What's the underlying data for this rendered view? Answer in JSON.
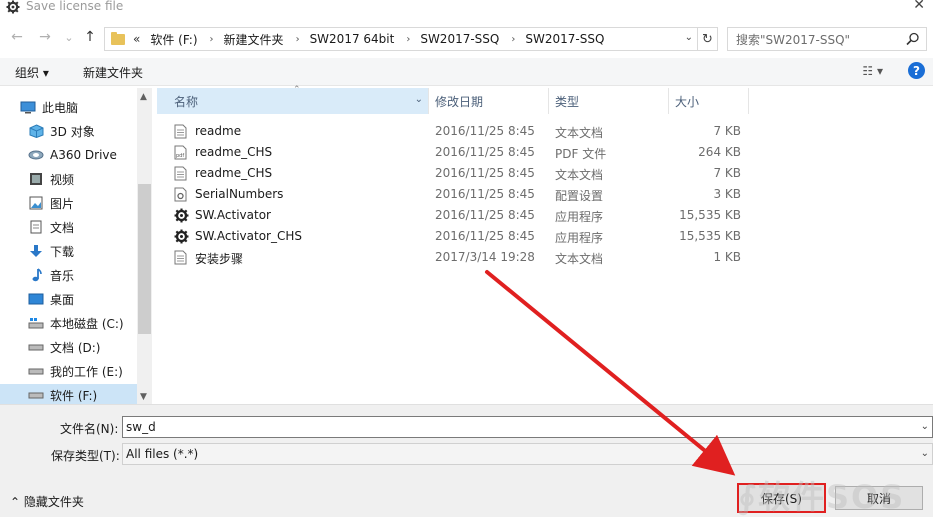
{
  "window": {
    "title": "Save license file",
    "close_glyph": "✕"
  },
  "nav": {
    "back": "←",
    "forward": "→",
    "recent": "⌄",
    "up": "↑",
    "breadcrumb_lead": "«",
    "breadcrumb": [
      "软件 (F:)",
      "新建文件夹",
      "SW2017 64bit",
      "SW2017-SSQ",
      "SW2017-SSQ"
    ],
    "crumb_sep": "›",
    "search_placeholder": "搜索\"SW2017-SSQ\""
  },
  "toolbar": {
    "organize": "组织 ▾",
    "new_folder": "新建文件夹",
    "view_glyph": "☷ ▾",
    "help": "?"
  },
  "sidebar": {
    "items": [
      {
        "label": "此电脑",
        "icon": "computer-icon"
      },
      {
        "label": "3D 对象",
        "icon": "3d-objects-icon"
      },
      {
        "label": "A360 Drive",
        "icon": "cloud-drive-icon"
      },
      {
        "label": "视频",
        "icon": "video-icon"
      },
      {
        "label": "图片",
        "icon": "pictures-icon"
      },
      {
        "label": "文档",
        "icon": "documents-icon"
      },
      {
        "label": "下载",
        "icon": "download-icon"
      },
      {
        "label": "音乐",
        "icon": "music-icon"
      },
      {
        "label": "桌面",
        "icon": "desktop-icon"
      },
      {
        "label": "本地磁盘 (C:)",
        "icon": "system-drive-icon"
      },
      {
        "label": "文档 (D:)",
        "icon": "drive-icon"
      },
      {
        "label": "我的工作 (E:)",
        "icon": "drive-icon"
      },
      {
        "label": "软件 (F:)",
        "icon": "drive-icon"
      }
    ]
  },
  "columns": {
    "name": "名称",
    "date": "修改日期",
    "type": "类型",
    "size": "大小"
  },
  "files": [
    {
      "name": "readme",
      "date": "2016/11/25 8:45",
      "type": "文本文档",
      "size": "7 KB",
      "icon": "text-file-icon"
    },
    {
      "name": "readme_CHS",
      "date": "2016/11/25 8:45",
      "type": "PDF 文件",
      "size": "264 KB",
      "icon": "pdf-file-icon"
    },
    {
      "name": "readme_CHS",
      "date": "2016/11/25 8:45",
      "type": "文本文档",
      "size": "7 KB",
      "icon": "text-file-icon"
    },
    {
      "name": "SerialNumbers",
      "date": "2016/11/25 8:45",
      "type": "配置设置",
      "size": "3 KB",
      "icon": "config-file-icon"
    },
    {
      "name": "SW.Activator",
      "date": "2016/11/25 8:45",
      "type": "应用程序",
      "size": "15,535 KB",
      "icon": "gear-icon"
    },
    {
      "name": "SW.Activator_CHS",
      "date": "2016/11/25 8:45",
      "type": "应用程序",
      "size": "15,535 KB",
      "icon": "gear-icon"
    },
    {
      "name": "安装步骤",
      "date": "2017/3/14 19:28",
      "type": "文本文档",
      "size": "1 KB",
      "icon": "text-file-icon"
    }
  ],
  "form": {
    "filename_label": "文件名(N):",
    "filename_value": "sw_d",
    "filetype_label": "保存类型(T):",
    "filetype_value": "All files (*.*)",
    "hide_folders": "⌃ 隐藏文件夹",
    "save": "保存(S)",
    "cancel": "取消"
  },
  "watermark": "∮软件SOS",
  "colors": {
    "selection": "#cce4f7",
    "header_active": "#d9ebf9",
    "annotation": "#e02020",
    "help": "#1a6ed6"
  }
}
